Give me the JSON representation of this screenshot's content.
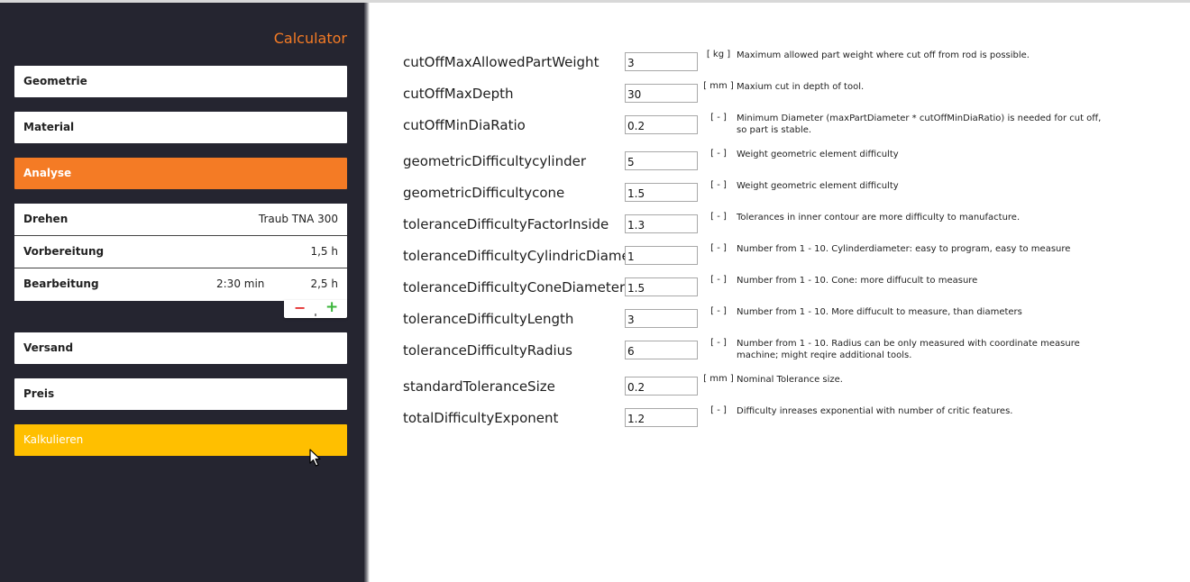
{
  "sidebar": {
    "title": "Calculator",
    "nav": {
      "geometrie": "Geometrie",
      "material": "Material",
      "analyse": "Analyse",
      "versand": "Versand",
      "preis": "Preis",
      "kalkulieren": "Kalkulieren"
    },
    "analyse_rows": [
      {
        "label": "Drehen",
        "mid": "",
        "value": "Traub TNA 300"
      },
      {
        "label": "Vorbereitung",
        "mid": "",
        "value": "1,5 h"
      },
      {
        "label": "Bearbeitung",
        "mid": "2:30 min",
        "value": "2,5 h"
      }
    ],
    "stepper": {
      "minus": "−",
      "plus": "+"
    }
  },
  "colors": {
    "sidebar_bg": "#252530",
    "accent_orange": "#f47b25",
    "calc_yellow": "#ffbf00",
    "minus_red": "#e53333",
    "plus_green": "#3ab53a"
  },
  "icons": {
    "cursor": "mouse-pointer-icon",
    "minus": "minus-icon",
    "plus": "plus-icon"
  },
  "params": [
    {
      "name": "cutOffMaxAllowedPartWeight",
      "value": "3",
      "unit": "[ kg ]",
      "desc": "Maximum allowed part weight where cut off from rod is possible."
    },
    {
      "name": "cutOffMaxDepth",
      "value": "30",
      "unit": "[ mm ]",
      "desc": "Maxium cut in depth of tool."
    },
    {
      "name": "cutOffMinDiaRatio",
      "value": "0.2",
      "unit": "[ - ]",
      "desc": "Minimum Diameter (maxPartDiameter * cutOffMinDiaRatio) is needed for cut off, so part is stable."
    },
    {
      "name": "geometricDifficultycylinder",
      "value": "5",
      "unit": "[ - ]",
      "desc": "Weight geometric element difficulty"
    },
    {
      "name": "geometricDifficultycone",
      "value": "1.5",
      "unit": "[ - ]",
      "desc": "Weight geometric element difficulty"
    },
    {
      "name": "toleranceDifficultyFactorInside",
      "value": "1.3",
      "unit": "[ - ]",
      "desc": "Tolerances in inner contour are more difficulty to manufacture."
    },
    {
      "name": "toleranceDifficultyCylindricDiameter",
      "value": "1",
      "unit": "[ - ]",
      "desc": "Number from 1 - 10. Cylinderdiameter: easy to program, easy to measure"
    },
    {
      "name": "toleranceDifficultyConeDiameter",
      "value": "1.5",
      "unit": "[ - ]",
      "desc": "Number from 1 - 10. Cone: more diffucult to measure"
    },
    {
      "name": "toleranceDifficultyLength",
      "value": "3",
      "unit": "[ - ]",
      "desc": "Number from 1 - 10. More diffucult to measure, than diameters"
    },
    {
      "name": "toleranceDifficultyRadius",
      "value": "6",
      "unit": "[ - ]",
      "desc": "Number from 1 - 10. Radius can be only measured with coordinate measure machine; might reqire additional tools."
    },
    {
      "name": "standardToleranceSize",
      "value": "0.2",
      "unit": "[ mm ]",
      "desc": "Nominal Tolerance size."
    },
    {
      "name": "totalDifficultyExponent",
      "value": "1.2",
      "unit": "[ - ]",
      "desc": "Difficulty inreases exponential with number of critic features."
    }
  ]
}
